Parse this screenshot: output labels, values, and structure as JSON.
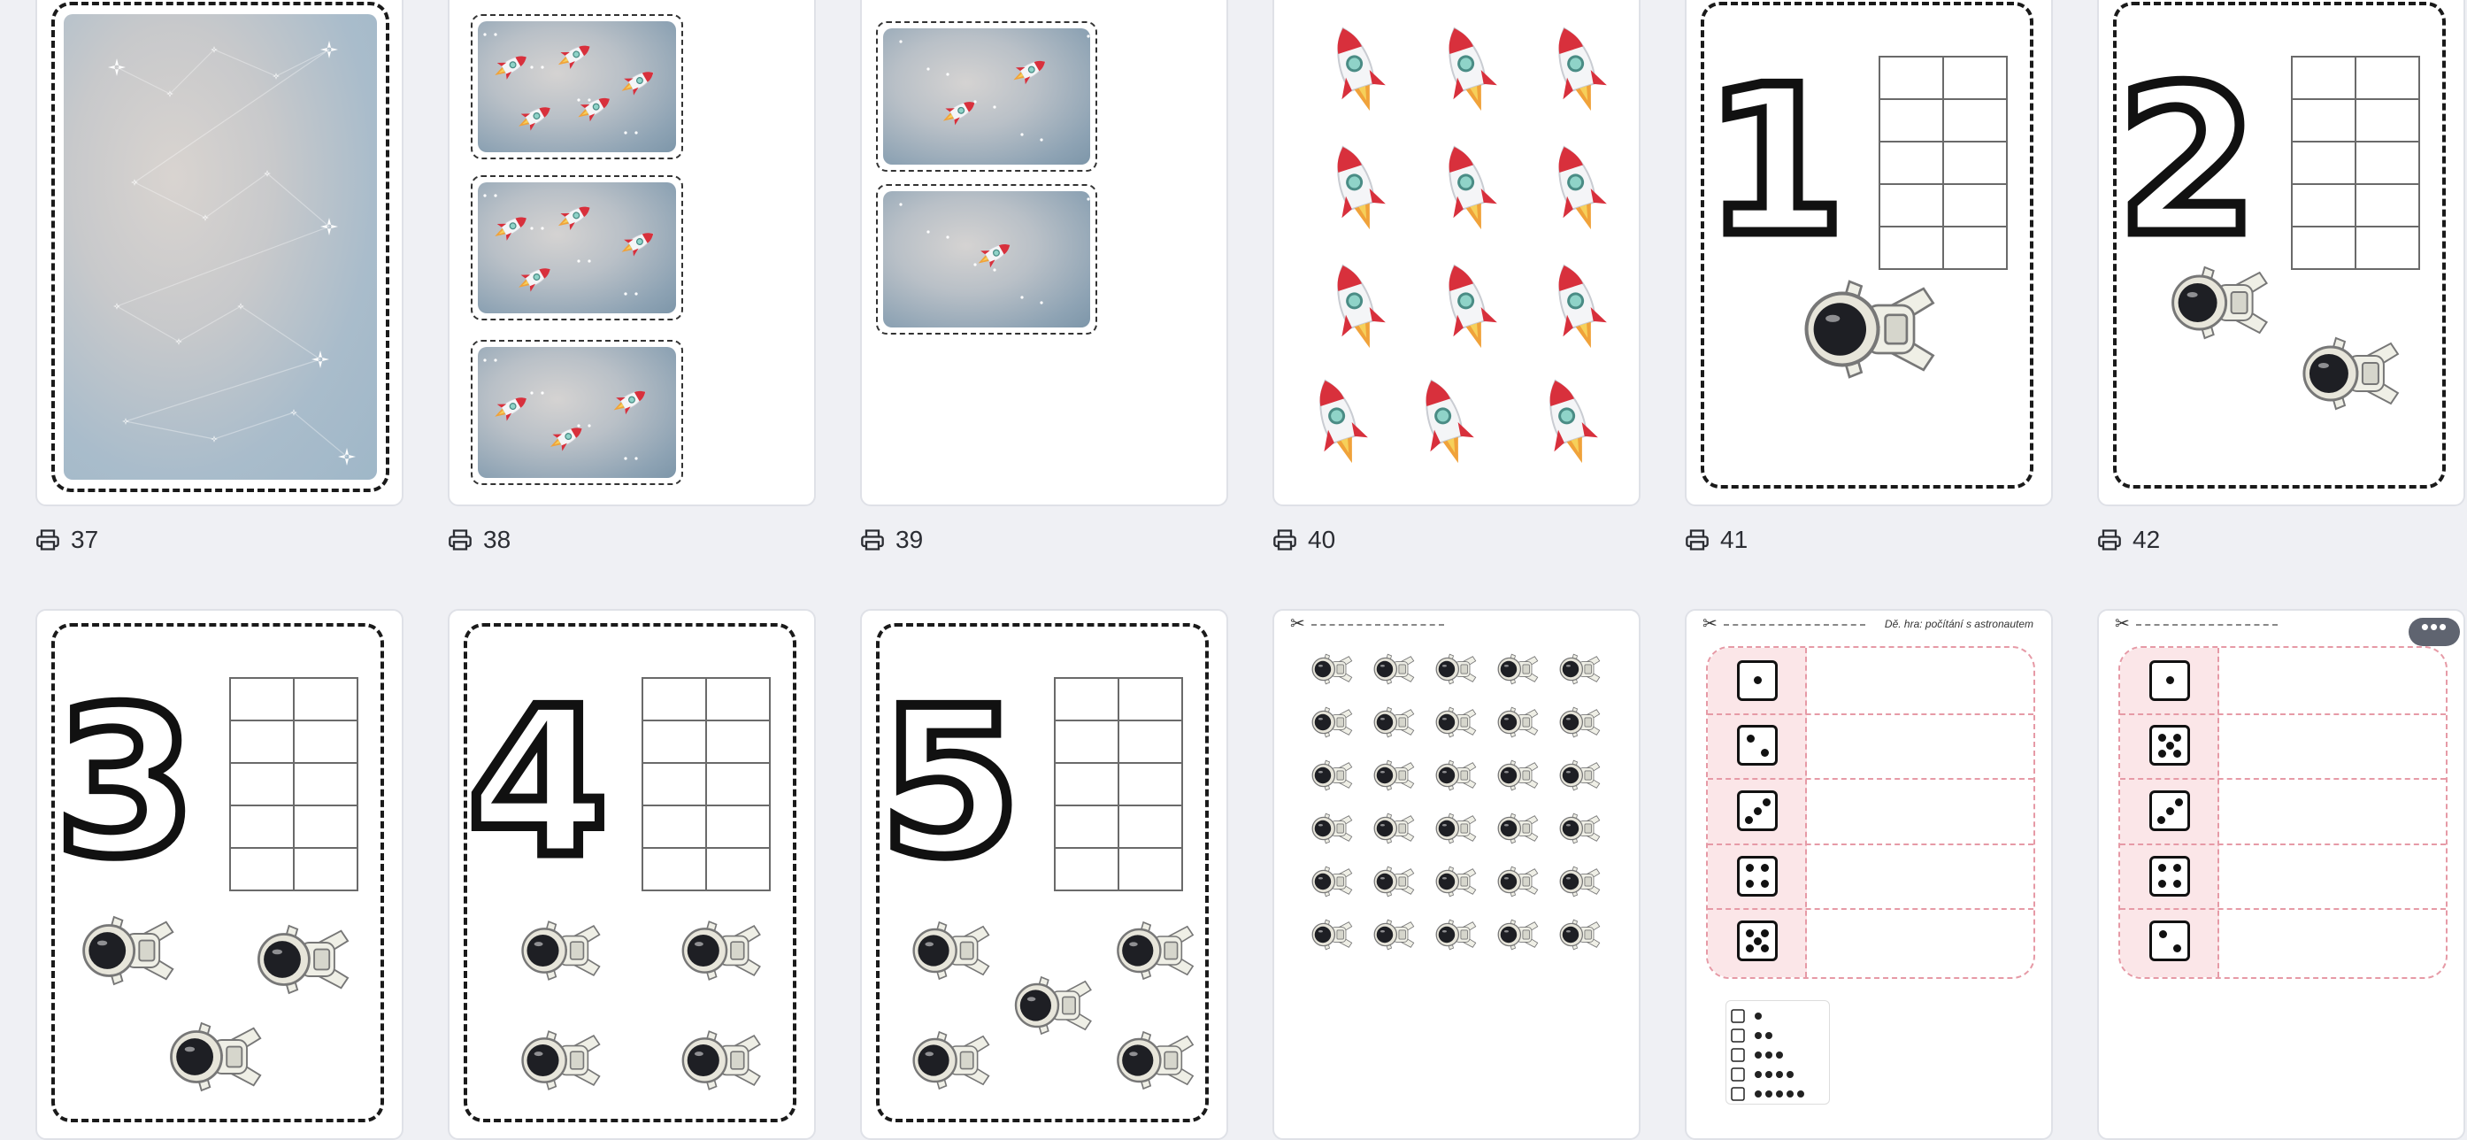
{
  "pages": [
    {
      "id": "p37",
      "number": "37",
      "kind": "stars-background"
    },
    {
      "id": "p38",
      "number": "38",
      "kind": "three-rocket-cards"
    },
    {
      "id": "p39",
      "number": "39",
      "kind": "two-rocket-cards"
    },
    {
      "id": "p40",
      "number": "40",
      "kind": "rocket-cutouts"
    },
    {
      "id": "p41",
      "number": "41",
      "kind": "numeral-card",
      "numeral": "1",
      "astronauts": 1
    },
    {
      "id": "p42",
      "number": "42",
      "kind": "numeral-card",
      "numeral": "2",
      "astronauts": 2
    },
    {
      "id": "p43",
      "kind": "numeral-card",
      "numeral": "3",
      "astronauts": 3
    },
    {
      "id": "p44",
      "kind": "numeral-card",
      "numeral": "4",
      "astronauts": 4
    },
    {
      "id": "p45",
      "kind": "numeral-card",
      "numeral": "5",
      "astronauts": 5
    },
    {
      "id": "p46",
      "kind": "astronaut-cutouts",
      "rows": 6,
      "cols": 5
    },
    {
      "id": "p47",
      "kind": "dice-board",
      "header": "Dě. hra: počítání s astronautem",
      "dice": [
        1,
        2,
        3,
        4,
        5
      ]
    },
    {
      "id": "p48",
      "kind": "dice-board",
      "dice": [
        1,
        5,
        3,
        4,
        2
      ]
    }
  ],
  "icons": {
    "print": "print-icon",
    "cut": "scissors-icon",
    "more": "more-icon"
  },
  "more_label": "•••",
  "scissors": "✂",
  "colors": {
    "background": "#eff0f4",
    "rocket_red": "#d8303c",
    "rocket_flame": "#f0a23a",
    "board_pink": "#fbe6e8",
    "board_border": "#e69aa6"
  }
}
